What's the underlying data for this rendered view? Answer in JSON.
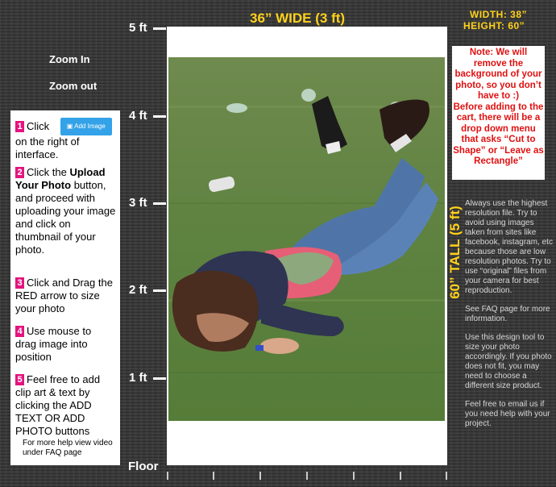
{
  "ruler": {
    "labels": [
      "5 ft",
      "4 ft",
      "3 ft",
      "2 ft",
      "1 ft"
    ],
    "floor": "Floor"
  },
  "header": {
    "title": "36” WIDE (3 ft)",
    "width_label": "WIDTH: 38”",
    "height_label": "HEIGHT: 60”",
    "tall_label": "60” TALL (5 ft)"
  },
  "zoom": {
    "zoom_in": "Zoom In",
    "zoom_out": "Zoom out"
  },
  "instructions": {
    "step1_num": "1",
    "step1_a": "Click",
    "step1_button": "Add Image",
    "step1_b": "on the right of interface.",
    "step2_num": "2",
    "step2_a": "Click the ",
    "step2_bold": "Upload Your Photo",
    "step2_b": " button, and proceed with uploading your image and click on thumbnail of your photo.",
    "step3_num": "3",
    "step3": "Click and Drag the RED arrow to size your photo",
    "step4_num": "4",
    "step4": "Use mouse to drag image into position",
    "step5_num": "5",
    "step5": "Feel free to add clip art & text by clicking the ADD TEXT OR ADD PHOTO buttons",
    "help": "For more help view video under FAQ page"
  },
  "note": {
    "text": "Note: We will remove the background of your photo, so you don’t have to :)",
    "text2": "Before adding to the cart, there will be a drop down menu that asks “Cut to Shape” or “Leave as Rectangle”"
  },
  "tips": {
    "p1": "Always use the highest resolution file. Try to avoid using images taken from sites like facebook, instagram, etc because those are low resolution photos. Try to use “original” files from your camera for best reproduction.",
    "p2": "See FAQ page for more information.",
    "p3": "Use this design tool to size your photo accordingly. If you photo does not fit, you may need to choose a different size product.",
    "p4": "Feel free to email us if you need help with your project."
  },
  "colors": {
    "accent_yellow": "#ffd21a",
    "step_pink": "#e3147e",
    "button_blue": "#33a2e8",
    "note_red": "#e01010"
  }
}
